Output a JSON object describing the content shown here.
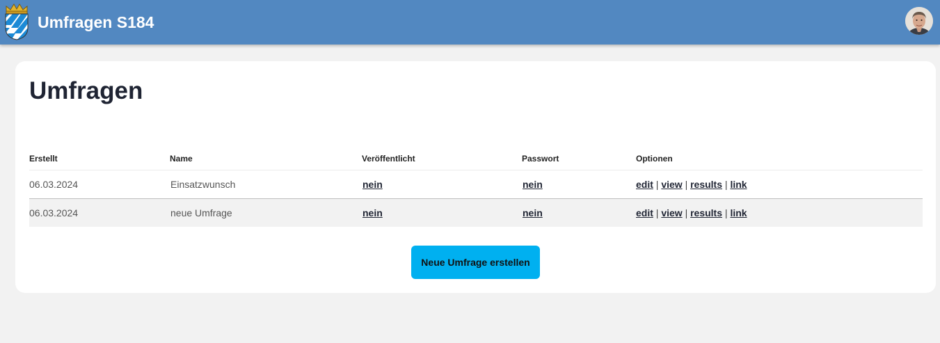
{
  "header": {
    "app_title": "Umfragen S184",
    "logo_icon": "bavaria-coat-of-arms-icon",
    "avatar_icon": "user-avatar",
    "background_color": "#5288c1"
  },
  "main": {
    "page_title": "Umfragen",
    "table": {
      "columns": [
        "Erstellt",
        "Name",
        "Veröffentlicht",
        "Passwort",
        "Optionen"
      ],
      "rows": [
        {
          "erstellt": "06.03.2024",
          "name": "Einsatzwunsch",
          "veroeffentlicht": "nein",
          "passwort": "nein",
          "options": {
            "edit": "edit",
            "view": "view",
            "results": "results",
            "link": "link"
          }
        },
        {
          "erstellt": "06.03.2024",
          "name": "neue Umfrage",
          "veroeffentlicht": "nein",
          "passwort": "nein",
          "options": {
            "edit": "edit",
            "view": "view",
            "results": "results",
            "link": "link"
          }
        }
      ],
      "option_separator": "|"
    },
    "new_button_label": "Neue Umfrage erstellen",
    "accent_color": "#00b0f0"
  }
}
